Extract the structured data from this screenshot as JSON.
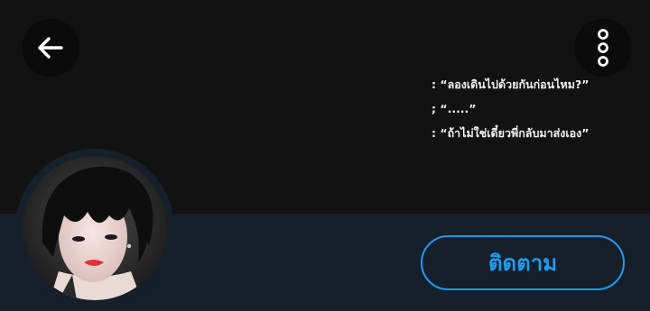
{
  "header": {
    "back_icon": "arrow-left-icon",
    "more_icon": "more-vertical-icon"
  },
  "banner": {
    "lines": [
      ": “ลองเดินไปด้วยกันก่อนไหม?”",
      "; “.....”",
      ": “ถ้าไม่ใช่เดี๋ยวพี่กลับมาส่งเอง”"
    ]
  },
  "profile": {
    "follow_label": "ติดตาม"
  },
  "colors": {
    "accent": "#1d9bf0",
    "background": "#15202b",
    "banner": "#121212"
  }
}
